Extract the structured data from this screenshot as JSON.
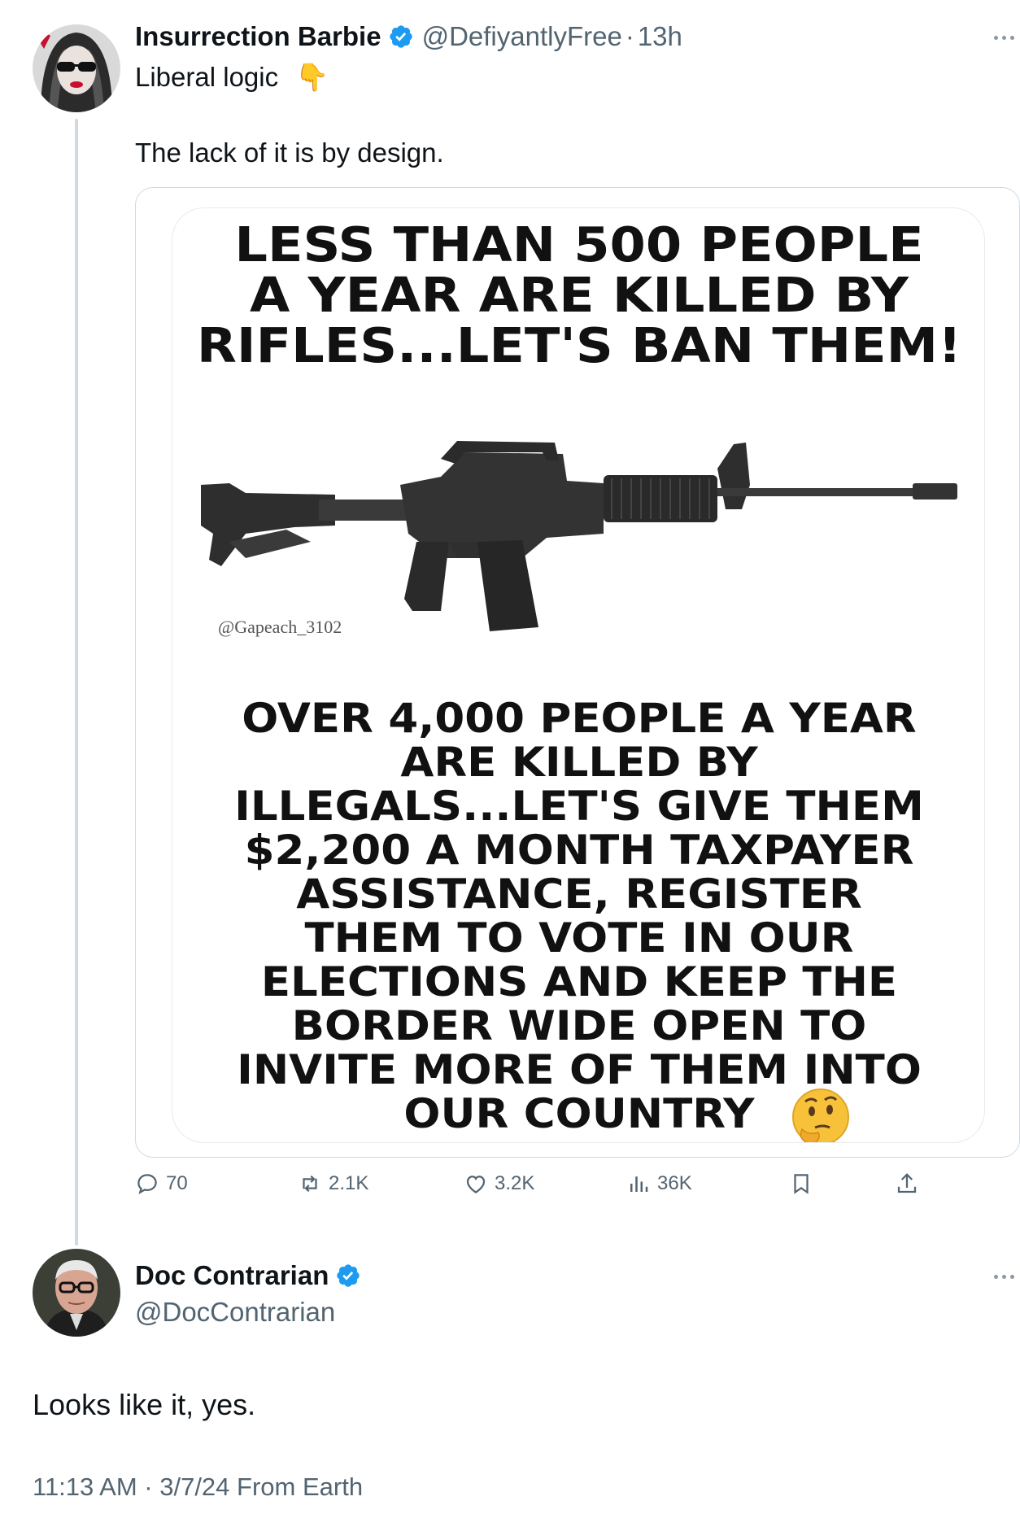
{
  "original_tweet": {
    "display_name": "Insurrection Barbie",
    "handle": "@DefiyantlyFree",
    "separator": "·",
    "time_ago": "13h",
    "line1": "Liberal logic",
    "line1_emoji": "👇",
    "line2": "The lack of it is by design.",
    "meme": {
      "top_text": "LESS THAN 500 PEOPLE\nA YEAR ARE KILLED BY\nRIFLES...LET'S BAN THEM!",
      "watermark": "@Gapeach_3102",
      "bottom_text": "OVER 4,000 PEOPLE A YEAR\nARE KILLED BY\nILLEGALS...LET'S GIVE THEM\n$2,200 A MONTH TAXPAYER\nASSISTANCE, REGISTER\nTHEM TO VOTE IN OUR\nELECTIONS AND KEEP THE\nBORDER WIDE OPEN TO\nINVITE MORE OF THEM INTO\nOUR COUNTRY",
      "emoji": "🤔"
    },
    "actions": {
      "replies": "70",
      "reposts": "2.1K",
      "likes": "3.2K",
      "views": "36K"
    }
  },
  "reply_tweet": {
    "display_name": "Doc Contrarian",
    "handle": "@DocContrarian",
    "text": "Looks like it, yes.",
    "timestamp": "11:13 AM · 3/7/24 From Earth"
  },
  "colors": {
    "verified_blue": "#1d9bf0",
    "secondary_text": "#536471",
    "thread_line": "#cfd9de"
  },
  "icons": [
    "verified-badge-icon",
    "more-icon",
    "reply-icon",
    "repost-icon",
    "like-icon",
    "views-icon",
    "bookmark-icon",
    "share-icon"
  ]
}
